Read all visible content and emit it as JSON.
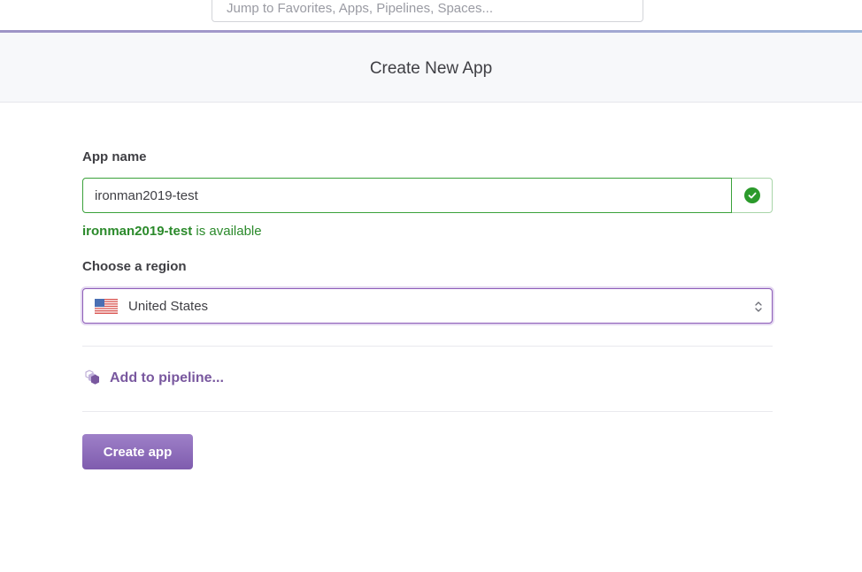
{
  "search": {
    "placeholder": "Jump to Favorites, Apps, Pipelines, Spaces..."
  },
  "header": {
    "title": "Create New App"
  },
  "form": {
    "app_name_label": "App name",
    "app_name_value": "ironman2019-test",
    "availability": {
      "name": "ironman2019-test",
      "suffix": " is available"
    },
    "region_label": "Choose a region",
    "region_value": "United States",
    "pipeline_link": "Add to pipeline...",
    "create_button": "Create app"
  },
  "colors": {
    "accent": "#79589f",
    "success": "#2b9a2b",
    "button_top": "#9e80c8",
    "button_bottom": "#7f5cae"
  },
  "icons": {
    "search_status": "check-circle-icon",
    "region_flag": "us-flag-icon",
    "select_arrows": "chevron-up-down-icon",
    "pipeline": "pipeline-hexagon-icon"
  }
}
